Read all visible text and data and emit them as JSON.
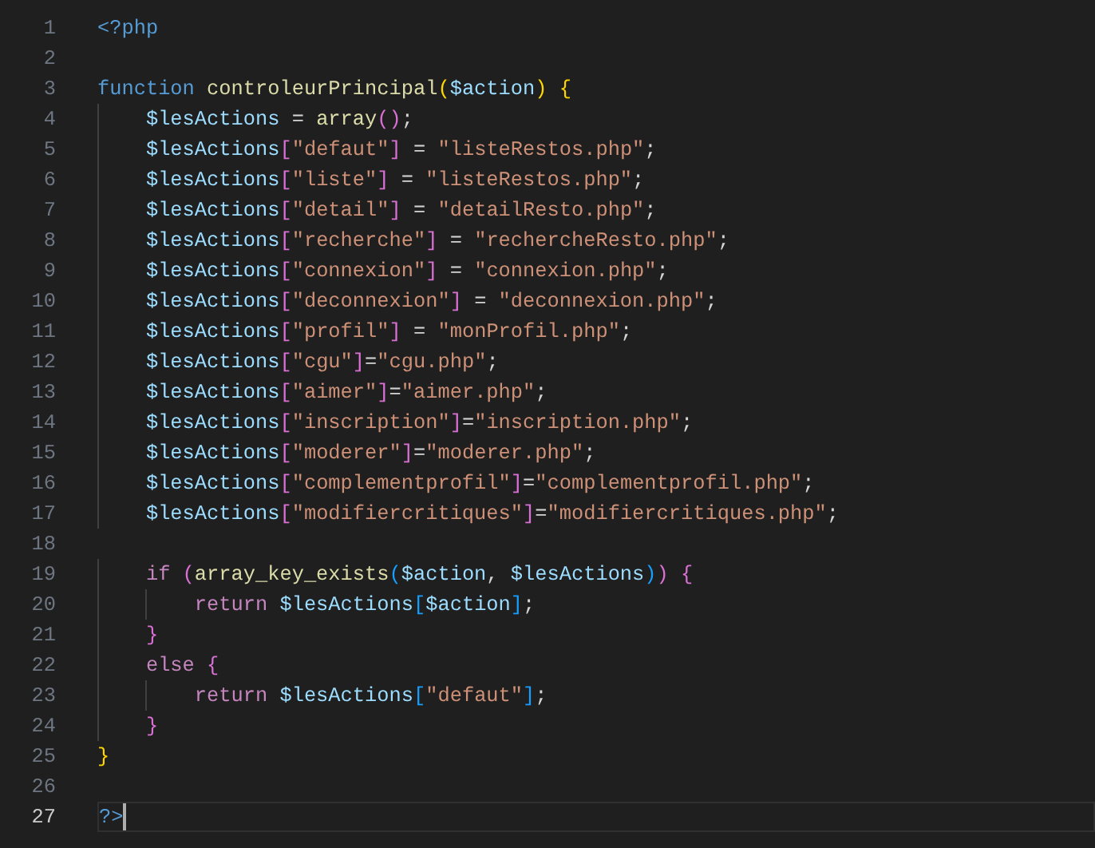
{
  "editor": {
    "lines": [
      {
        "number": "1",
        "current": false,
        "tokens": [
          {
            "text": "<?php",
            "kind": "tag"
          }
        ]
      },
      {
        "number": "2",
        "current": false
      },
      {
        "number": "3",
        "current": false,
        "tokens": [
          {
            "text": "function ",
            "kind": "storage"
          },
          {
            "text": "controleurPrincipal",
            "kind": "function"
          },
          {
            "text": "(",
            "kind": "bracket1"
          },
          {
            "text": "$action",
            "kind": "variable"
          },
          {
            "text": ")",
            "kind": "bracket1"
          },
          {
            "text": " {",
            "kind": "bracket1"
          }
        ]
      },
      {
        "number": "4",
        "current": false,
        "tokens": [
          {
            "text": "    $lesActions",
            "kind": "variable"
          },
          {
            "text": " = ",
            "kind": "plain"
          },
          {
            "text": "array",
            "kind": "function"
          },
          {
            "text": "()",
            "kind": "bracket2"
          },
          {
            "text": ";",
            "kind": "plain"
          }
        ]
      },
      {
        "number": "5",
        "current": false,
        "tokens": [
          {
            "text": "    $lesActions",
            "kind": "variable"
          },
          {
            "text": "[",
            "kind": "bracket2"
          },
          {
            "text": "\"defaut\"",
            "kind": "string"
          },
          {
            "text": "]",
            "kind": "bracket2"
          },
          {
            "text": " = ",
            "kind": "plain"
          },
          {
            "text": "\"listeRestos.php\"",
            "kind": "string"
          },
          {
            "text": ";",
            "kind": "plain"
          }
        ]
      },
      {
        "number": "6",
        "current": false,
        "tokens": [
          {
            "text": "    $lesActions",
            "kind": "variable"
          },
          {
            "text": "[",
            "kind": "bracket2"
          },
          {
            "text": "\"liste\"",
            "kind": "string"
          },
          {
            "text": "]",
            "kind": "bracket2"
          },
          {
            "text": " = ",
            "kind": "plain"
          },
          {
            "text": "\"listeRestos.php\"",
            "kind": "string"
          },
          {
            "text": ";",
            "kind": "plain"
          }
        ]
      },
      {
        "number": "7",
        "current": false,
        "tokens": [
          {
            "text": "    $lesActions",
            "kind": "variable"
          },
          {
            "text": "[",
            "kind": "bracket2"
          },
          {
            "text": "\"detail\"",
            "kind": "string"
          },
          {
            "text": "]",
            "kind": "bracket2"
          },
          {
            "text": " = ",
            "kind": "plain"
          },
          {
            "text": "\"detailResto.php\"",
            "kind": "string"
          },
          {
            "text": ";",
            "kind": "plain"
          }
        ]
      },
      {
        "number": "8",
        "current": false,
        "tokens": [
          {
            "text": "    $lesActions",
            "kind": "variable"
          },
          {
            "text": "[",
            "kind": "bracket2"
          },
          {
            "text": "\"recherche\"",
            "kind": "string"
          },
          {
            "text": "]",
            "kind": "bracket2"
          },
          {
            "text": " = ",
            "kind": "plain"
          },
          {
            "text": "\"rechercheResto.php\"",
            "kind": "string"
          },
          {
            "text": ";",
            "kind": "plain"
          }
        ]
      },
      {
        "number": "9",
        "current": false,
        "tokens": [
          {
            "text": "    $lesActions",
            "kind": "variable"
          },
          {
            "text": "[",
            "kind": "bracket2"
          },
          {
            "text": "\"connexion\"",
            "kind": "string"
          },
          {
            "text": "]",
            "kind": "bracket2"
          },
          {
            "text": " = ",
            "kind": "plain"
          },
          {
            "text": "\"connexion.php\"",
            "kind": "string"
          },
          {
            "text": ";",
            "kind": "plain"
          }
        ]
      },
      {
        "number": "10",
        "current": false,
        "tokens": [
          {
            "text": "    $lesActions",
            "kind": "variable"
          },
          {
            "text": "[",
            "kind": "bracket2"
          },
          {
            "text": "\"deconnexion\"",
            "kind": "string"
          },
          {
            "text": "]",
            "kind": "bracket2"
          },
          {
            "text": " = ",
            "kind": "plain"
          },
          {
            "text": "\"deconnexion.php\"",
            "kind": "string"
          },
          {
            "text": ";",
            "kind": "plain"
          }
        ]
      },
      {
        "number": "11",
        "current": false,
        "tokens": [
          {
            "text": "    $lesActions",
            "kind": "variable"
          },
          {
            "text": "[",
            "kind": "bracket2"
          },
          {
            "text": "\"profil\"",
            "kind": "string"
          },
          {
            "text": "]",
            "kind": "bracket2"
          },
          {
            "text": " = ",
            "kind": "plain"
          },
          {
            "text": "\"monProfil.php\"",
            "kind": "string"
          },
          {
            "text": ";",
            "kind": "plain"
          }
        ]
      },
      {
        "number": "12",
        "current": false,
        "tokens": [
          {
            "text": "    $lesActions",
            "kind": "variable"
          },
          {
            "text": "[",
            "kind": "bracket2"
          },
          {
            "text": "\"cgu\"",
            "kind": "string"
          },
          {
            "text": "]",
            "kind": "bracket2"
          },
          {
            "text": "=",
            "kind": "plain"
          },
          {
            "text": "\"cgu.php\"",
            "kind": "string"
          },
          {
            "text": ";",
            "kind": "plain"
          }
        ]
      },
      {
        "number": "13",
        "current": false,
        "tokens": [
          {
            "text": "    $lesActions",
            "kind": "variable"
          },
          {
            "text": "[",
            "kind": "bracket2"
          },
          {
            "text": "\"aimer\"",
            "kind": "string"
          },
          {
            "text": "]",
            "kind": "bracket2"
          },
          {
            "text": "=",
            "kind": "plain"
          },
          {
            "text": "\"aimer.php\"",
            "kind": "string"
          },
          {
            "text": ";",
            "kind": "plain"
          }
        ]
      },
      {
        "number": "14",
        "current": false,
        "tokens": [
          {
            "text": "    $lesActions",
            "kind": "variable"
          },
          {
            "text": "[",
            "kind": "bracket2"
          },
          {
            "text": "\"inscription\"",
            "kind": "string"
          },
          {
            "text": "]",
            "kind": "bracket2"
          },
          {
            "text": "=",
            "kind": "plain"
          },
          {
            "text": "\"inscription.php\"",
            "kind": "string"
          },
          {
            "text": ";",
            "kind": "plain"
          }
        ]
      },
      {
        "number": "15",
        "current": false,
        "tokens": [
          {
            "text": "    $lesActions",
            "kind": "variable"
          },
          {
            "text": "[",
            "kind": "bracket2"
          },
          {
            "text": "\"moderer\"",
            "kind": "string"
          },
          {
            "text": "]",
            "kind": "bracket2"
          },
          {
            "text": "=",
            "kind": "plain"
          },
          {
            "text": "\"moderer.php\"",
            "kind": "string"
          },
          {
            "text": ";",
            "kind": "plain"
          }
        ]
      },
      {
        "number": "16",
        "current": false,
        "tokens": [
          {
            "text": "    $lesActions",
            "kind": "variable"
          },
          {
            "text": "[",
            "kind": "bracket2"
          },
          {
            "text": "\"complementprofil\"",
            "kind": "string"
          },
          {
            "text": "]",
            "kind": "bracket2"
          },
          {
            "text": "=",
            "kind": "plain"
          },
          {
            "text": "\"complementprofil.php\"",
            "kind": "string"
          },
          {
            "text": ";",
            "kind": "plain"
          }
        ]
      },
      {
        "number": "17",
        "current": false,
        "tokens": [
          {
            "text": "    $lesActions",
            "kind": "variable"
          },
          {
            "text": "[",
            "kind": "bracket2"
          },
          {
            "text": "\"modifiercritiques\"",
            "kind": "string"
          },
          {
            "text": "]",
            "kind": "bracket2"
          },
          {
            "text": "=",
            "kind": "plain"
          },
          {
            "text": "\"modifiercritiques.php\"",
            "kind": "string"
          },
          {
            "text": ";",
            "kind": "plain"
          }
        ]
      },
      {
        "number": "18",
        "current": false
      },
      {
        "number": "19",
        "current": false,
        "tokens": [
          {
            "text": "    if ",
            "kind": "control"
          },
          {
            "text": "(",
            "kind": "bracket2"
          },
          {
            "text": "array_key_exists",
            "kind": "function"
          },
          {
            "text": "(",
            "kind": "bracket3"
          },
          {
            "text": "$action",
            "kind": "variable"
          },
          {
            "text": ", ",
            "kind": "plain"
          },
          {
            "text": "$lesActions",
            "kind": "variable"
          },
          {
            "text": ")",
            "kind": "bracket3"
          },
          {
            "text": ")",
            "kind": "bracket2"
          },
          {
            "text": " {",
            "kind": "bracket2"
          }
        ]
      },
      {
        "number": "20",
        "current": false,
        "tokens": [
          {
            "text": "        return ",
            "kind": "control"
          },
          {
            "text": "$lesActions",
            "kind": "variable"
          },
          {
            "text": "[",
            "kind": "bracket3"
          },
          {
            "text": "$action",
            "kind": "variable"
          },
          {
            "text": "]",
            "kind": "bracket3"
          },
          {
            "text": ";",
            "kind": "plain"
          }
        ]
      },
      {
        "number": "21",
        "current": false,
        "tokens": [
          {
            "text": "    }",
            "kind": "bracket2"
          }
        ]
      },
      {
        "number": "22",
        "current": false,
        "tokens": [
          {
            "text": "    else ",
            "kind": "control"
          },
          {
            "text": "{",
            "kind": "bracket2"
          }
        ]
      },
      {
        "number": "23",
        "current": false,
        "tokens": [
          {
            "text": "        return ",
            "kind": "control"
          },
          {
            "text": "$lesActions",
            "kind": "variable"
          },
          {
            "text": "[",
            "kind": "bracket3"
          },
          {
            "text": "\"defaut\"",
            "kind": "string"
          },
          {
            "text": "]",
            "kind": "bracket3"
          },
          {
            "text": ";",
            "kind": "plain"
          }
        ]
      },
      {
        "number": "24",
        "current": false,
        "tokens": [
          {
            "text": "    }",
            "kind": "bracket2"
          }
        ]
      },
      {
        "number": "25",
        "current": false,
        "tokens": [
          {
            "text": "}",
            "kind": "bracket1"
          }
        ]
      },
      {
        "number": "26",
        "current": false
      },
      {
        "number": "27",
        "current": true,
        "tokens": [
          {
            "text": "?>",
            "kind": "tag"
          }
        ]
      }
    ]
  }
}
